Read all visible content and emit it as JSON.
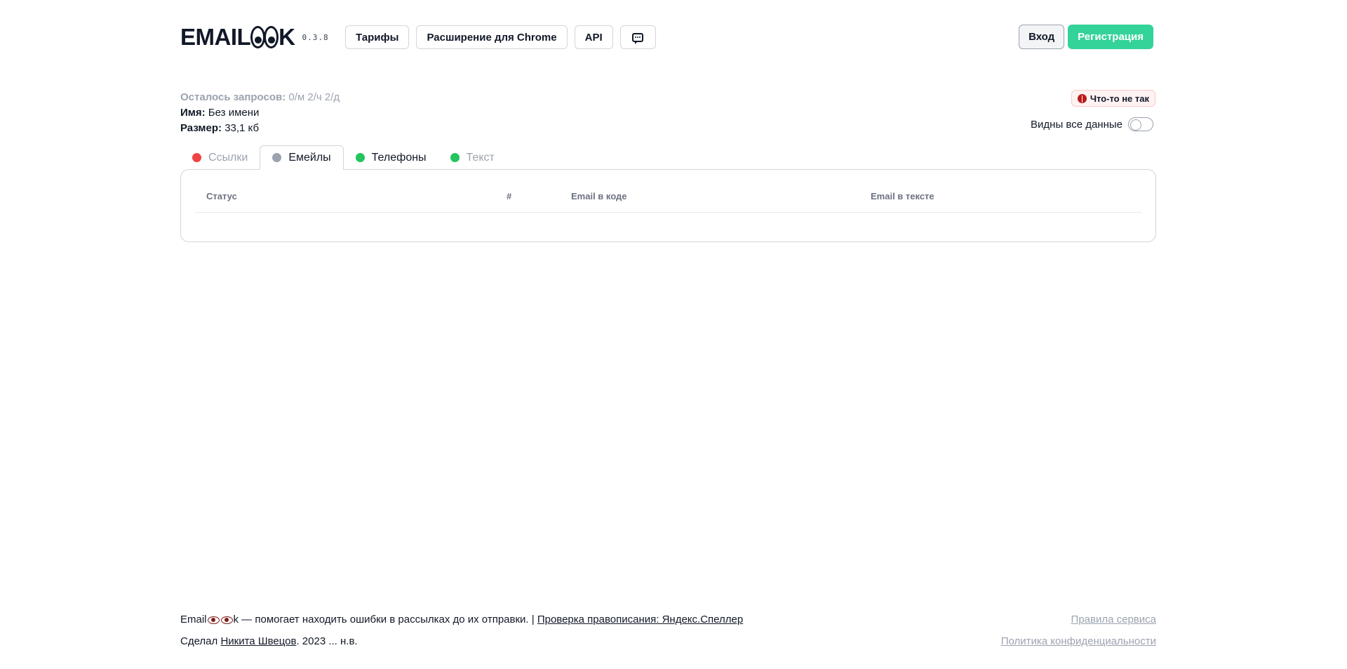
{
  "header": {
    "logo_left": "EMAIL",
    "logo_right": "K",
    "version": "0.3.8",
    "nav": [
      "Тарифы",
      "Расширение для Chrome",
      "API"
    ],
    "login": "Вход",
    "register": "Регистрация"
  },
  "info": {
    "requests_label": "Осталось запросов:",
    "requests_value": "0/м 2/ч 2/д",
    "name_label": "Имя:",
    "name_value": "Без имени",
    "size_label": "Размер:",
    "size_value": "33,1 кб"
  },
  "bug_button": "Что-то не так",
  "toggle_label": "Видны все данные",
  "tabs": [
    {
      "label": "Ссылки",
      "color": "#ef4444",
      "active": false
    },
    {
      "label": "Емейлы",
      "color": "#9ca3af",
      "active": true
    },
    {
      "label": "Телефоны",
      "color": "#22c55e",
      "active": false
    },
    {
      "label": "Текст",
      "color": "#22c55e",
      "active": false
    }
  ],
  "table": {
    "columns": [
      "Статус",
      "#",
      "Email в коде",
      "Email в тексте"
    ]
  },
  "footer": {
    "line1_start": "Email",
    "line1_mid": "k — помогает находить ошибки в рассылках до их отправки. |",
    "speller_link": "Проверка правописания: Яндекс.Спеллер",
    "line2_start": "Сделал",
    "author_link": "Никита Швецов",
    "line2_end": ". 2023 ... н.в.",
    "rules_link": "Правила сервиса",
    "privacy_link": "Политика конфиденциальности"
  }
}
